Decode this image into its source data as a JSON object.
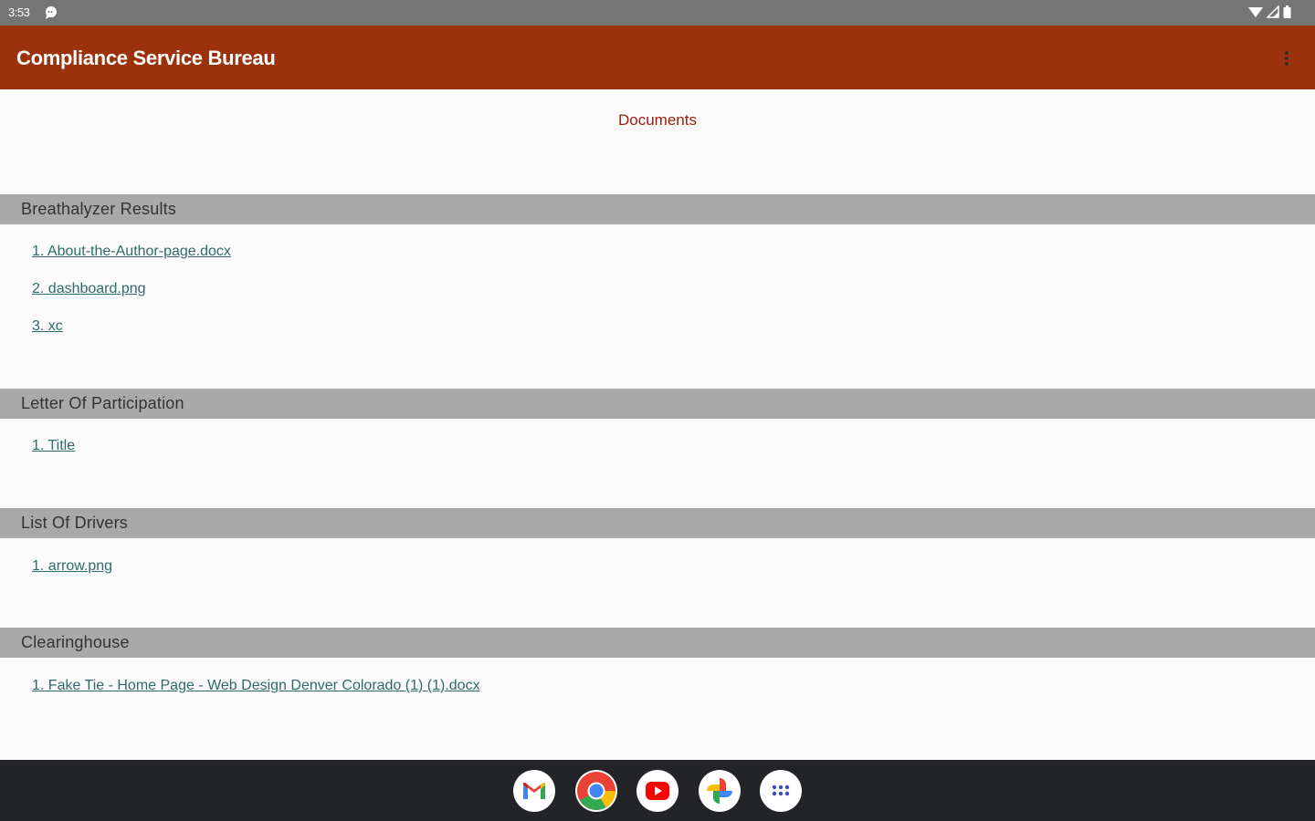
{
  "status_bar": {
    "time": "3:53"
  },
  "app_bar": {
    "title": "Compliance Service Bureau"
  },
  "page": {
    "heading": "Documents"
  },
  "sections": [
    {
      "title": "Breathalyzer Results",
      "documents": [
        "1. About-the-Author-page.docx",
        "2. dashboard.png",
        "3. xc"
      ]
    },
    {
      "title": "Letter Of Participation",
      "documents": [
        "1. Title"
      ]
    },
    {
      "title": "List Of Drivers",
      "documents": [
        "1. arrow.png"
      ]
    },
    {
      "title": "Clearinghouse",
      "documents": [
        "1. Fake Tie - Home Page - Web Design Denver Colorado (1) (1).docx"
      ]
    }
  ],
  "dock": {
    "apps": [
      "gmail-icon",
      "chrome-icon",
      "youtube-icon",
      "photos-icon",
      "app-launcher-icon"
    ]
  },
  "colors": {
    "app_bar": "#9b320b",
    "heading": "#9b1c0d",
    "section_header_bg": "#a9a9a9",
    "link": "#2f6b6b",
    "status_bar": "#757575",
    "taskbar": "#232427"
  }
}
